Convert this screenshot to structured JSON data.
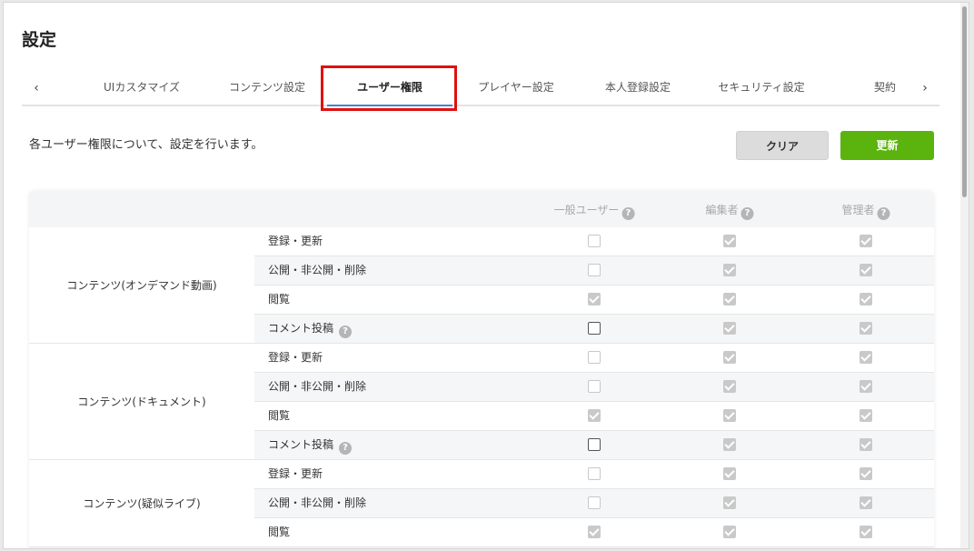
{
  "page": {
    "title": "設定"
  },
  "tabs": {
    "prev_icon": "chevron-left-icon",
    "next_icon": "chevron-right-icon",
    "prev_glyph": "‹",
    "next_glyph": "›",
    "items": [
      {
        "label": "UIカスタマイズ"
      },
      {
        "label": "コンテンツ設定"
      },
      {
        "label": "ユーザー権限",
        "active": true
      },
      {
        "label": "プレイヤー設定"
      },
      {
        "label": "本人登録設定"
      },
      {
        "label": "セキュリティ設定"
      },
      {
        "label": "契約"
      }
    ]
  },
  "description": "各ユーザー権限について、設定を行います。",
  "buttons": {
    "clear": "クリア",
    "update": "更新"
  },
  "columns": [
    {
      "label": "一般ユーザー",
      "help": "?"
    },
    {
      "label": "編集者",
      "help": "?"
    },
    {
      "label": "管理者",
      "help": "?"
    }
  ],
  "groups": [
    {
      "label": "コンテンツ(オンデマンド動画)",
      "rows": [
        {
          "label": "登録・更新",
          "help": "",
          "values": [
            "empty",
            "checked",
            "checked"
          ]
        },
        {
          "label": "公開・非公開・削除",
          "help": "",
          "values": [
            "empty",
            "checked",
            "checked"
          ]
        },
        {
          "label": "閲覧",
          "help": "",
          "values": [
            "checked",
            "checked",
            "checked"
          ]
        },
        {
          "label": "コメント投稿",
          "help": "?",
          "values": [
            "empty-dark",
            "checked",
            "checked"
          ]
        }
      ]
    },
    {
      "label": "コンテンツ(ドキュメント)",
      "rows": [
        {
          "label": "登録・更新",
          "help": "",
          "values": [
            "empty",
            "checked",
            "checked"
          ]
        },
        {
          "label": "公開・非公開・削除",
          "help": "",
          "values": [
            "empty",
            "checked",
            "checked"
          ]
        },
        {
          "label": "閲覧",
          "help": "",
          "values": [
            "checked",
            "checked",
            "checked"
          ]
        },
        {
          "label": "コメント投稿",
          "help": "?",
          "values": [
            "empty-dark",
            "checked",
            "checked"
          ]
        }
      ]
    },
    {
      "label": "コンテンツ(疑似ライブ)",
      "rows": [
        {
          "label": "登録・更新",
          "help": "",
          "values": [
            "empty",
            "checked",
            "checked"
          ]
        },
        {
          "label": "公開・非公開・削除",
          "help": "",
          "values": [
            "empty",
            "checked",
            "checked"
          ]
        },
        {
          "label": "閲覧",
          "help": "",
          "values": [
            "checked",
            "checked",
            "checked"
          ]
        }
      ]
    }
  ],
  "colors": {
    "accent": "#5bb30e",
    "tab_underline": "#4a7fd0",
    "highlight": "#e01010"
  }
}
